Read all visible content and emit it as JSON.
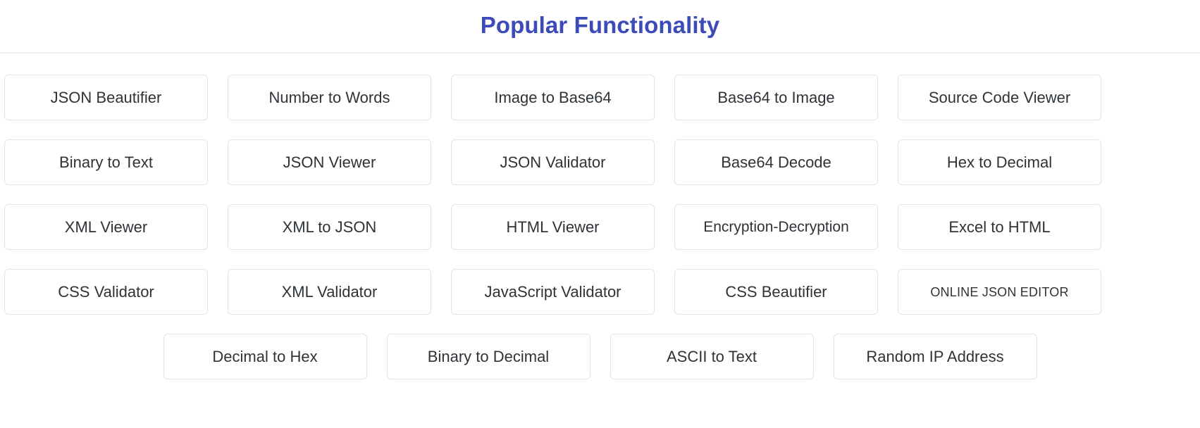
{
  "header": {
    "title": "Popular Functionality",
    "title_color": "#3c4bb8",
    "divider_color": "#f0f0f2"
  },
  "theme": {
    "background": "#ffffff",
    "tile_border": "#e2e4e7",
    "tile_text": "#2e3338",
    "tile_background": "#ffffff"
  },
  "grid": {
    "columns": 5,
    "rows": [
      {
        "name": "row-1",
        "centered": false,
        "tiles": [
          {
            "label": "JSON Beautifier",
            "style": "normal"
          },
          {
            "label": "Number to Words",
            "style": "normal"
          },
          {
            "label": "Image to Base64",
            "style": "normal"
          },
          {
            "label": "Base64 to Image",
            "style": "normal"
          },
          {
            "label": "Source Code Viewer",
            "style": "normal"
          }
        ]
      },
      {
        "name": "row-2",
        "centered": false,
        "tiles": [
          {
            "label": "Binary to Text",
            "style": "normal"
          },
          {
            "label": "JSON Viewer",
            "style": "normal"
          },
          {
            "label": "JSON Validator",
            "style": "normal"
          },
          {
            "label": "Base64 Decode",
            "style": "normal"
          },
          {
            "label": "Hex to Decimal",
            "style": "normal"
          }
        ]
      },
      {
        "name": "row-3",
        "centered": false,
        "tiles": [
          {
            "label": "XML Viewer",
            "style": "normal"
          },
          {
            "label": "XML to JSON",
            "style": "normal"
          },
          {
            "label": "HTML Viewer",
            "style": "normal"
          },
          {
            "label": "Encryption-Decryption",
            "style": "tight"
          },
          {
            "label": "Excel to HTML",
            "style": "normal"
          }
        ]
      },
      {
        "name": "row-4",
        "centered": false,
        "tiles": [
          {
            "label": "CSS Validator",
            "style": "normal"
          },
          {
            "label": "XML Validator",
            "style": "normal"
          },
          {
            "label": "JavaScript Validator",
            "style": "normal"
          },
          {
            "label": "CSS Beautifier",
            "style": "normal"
          },
          {
            "label": "ONLINE JSON EDITOR",
            "style": "small-caps"
          }
        ]
      },
      {
        "name": "row-5",
        "centered": true,
        "tiles": [
          {
            "label": "Decimal to Hex",
            "style": "normal"
          },
          {
            "label": "Binary to Decimal",
            "style": "normal"
          },
          {
            "label": "ASCII to Text",
            "style": "normal"
          },
          {
            "label": "Random IP Address",
            "style": "normal"
          }
        ]
      }
    ]
  }
}
